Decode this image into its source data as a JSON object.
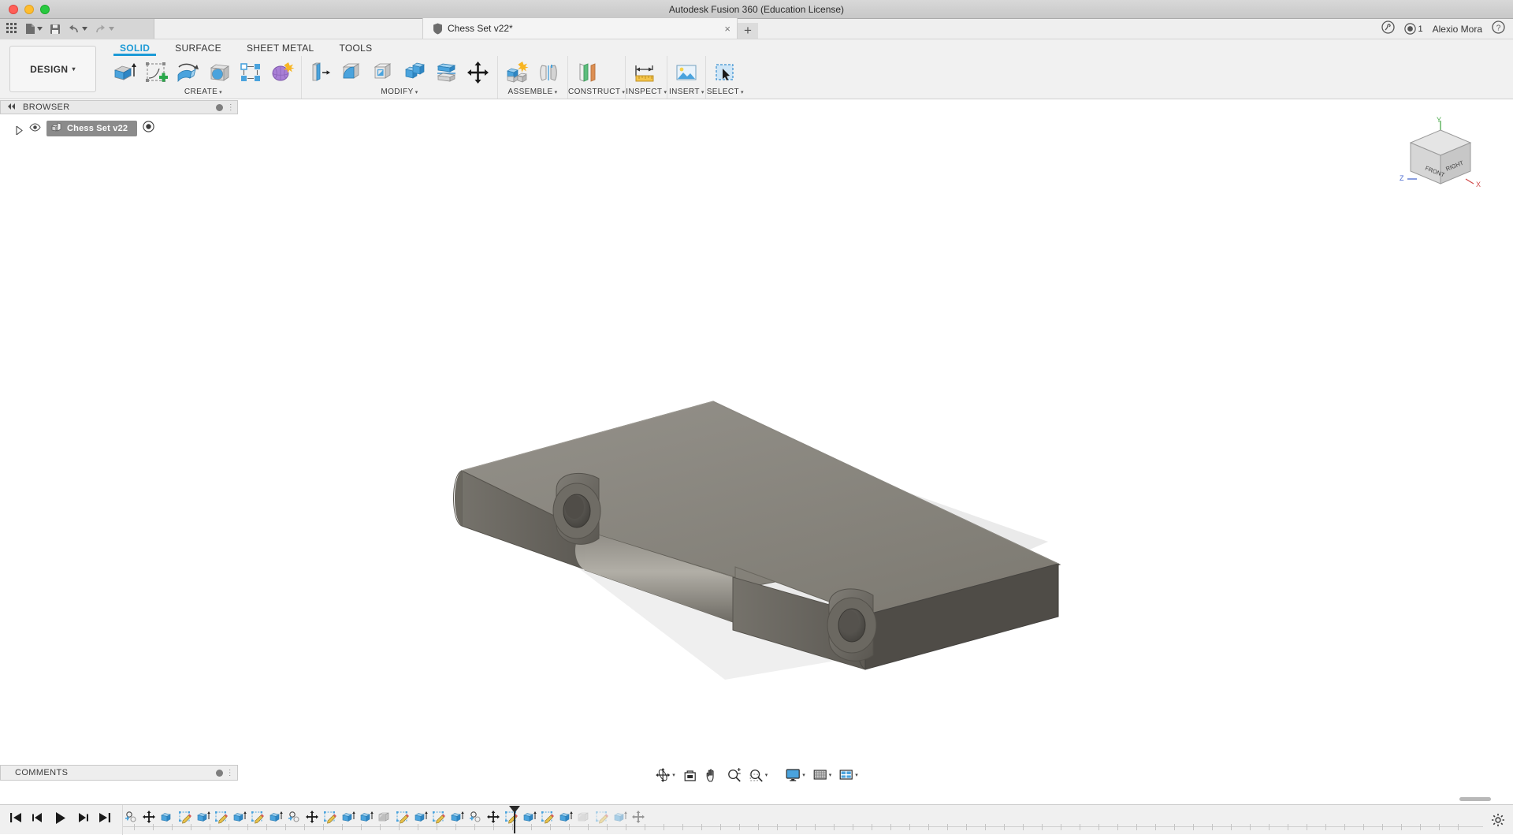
{
  "window": {
    "title": "Autodesk Fusion 360 (Education License)",
    "traffic_lights": [
      "close",
      "minimize",
      "maximize"
    ]
  },
  "quick_access": {
    "items": [
      {
        "name": "app-grid",
        "icon": "grid-icon"
      },
      {
        "name": "new-file",
        "icon": "file-icon",
        "has_dropdown": true
      },
      {
        "name": "save",
        "icon": "save-icon"
      },
      {
        "name": "undo",
        "icon": "undo-icon",
        "has_dropdown": true
      },
      {
        "name": "redo",
        "icon": "redo-icon",
        "has_dropdown": true
      }
    ]
  },
  "document_tab": {
    "label": "Chess Set v22*",
    "close": "×",
    "new_tab": "+"
  },
  "account": {
    "user_name": "Alexio Mora",
    "job_count": "1",
    "help_icon": "question-circle-icon",
    "extension_icon": "activity-icon"
  },
  "workspace": {
    "label": "DESIGN",
    "caret": "▾"
  },
  "ribbon": {
    "tabs": [
      {
        "label": "SOLID",
        "active": true
      },
      {
        "label": "SURFACE",
        "active": false
      },
      {
        "label": "SHEET METAL",
        "active": false
      },
      {
        "label": "TOOLS",
        "active": false
      }
    ],
    "panels": [
      {
        "label": "CREATE",
        "caret": "▾",
        "tools": [
          {
            "name": "extrude-tool",
            "icon": "extrude-icon"
          },
          {
            "name": "create-sketch-tool",
            "icon": "sketch-plus-icon"
          },
          {
            "name": "revolve-tool",
            "icon": "revolve-icon"
          },
          {
            "name": "sphere-tool",
            "icon": "sphere-in-box-icon"
          },
          {
            "name": "pattern-tool",
            "icon": "rect-pattern-icon"
          },
          {
            "name": "form-tool",
            "icon": "form-sculpt-icon"
          }
        ]
      },
      {
        "label": "MODIFY",
        "caret": "▾",
        "tools": [
          {
            "name": "press-pull-tool",
            "icon": "press-pull-icon"
          },
          {
            "name": "fillet-tool",
            "icon": "fillet-icon"
          },
          {
            "name": "shell-tool",
            "icon": "shell-icon"
          },
          {
            "name": "combine-tool",
            "icon": "combine-icon"
          },
          {
            "name": "split-face-tool",
            "icon": "split-face-icon"
          },
          {
            "name": "move-copy-tool",
            "icon": "move-arrows-icon"
          }
        ]
      },
      {
        "label": "ASSEMBLE",
        "caret": "▾",
        "tools": [
          {
            "name": "new-component-tool",
            "icon": "new-component-icon"
          },
          {
            "name": "joint-tool",
            "icon": "joint-icon"
          }
        ]
      },
      {
        "label": "CONSTRUCT",
        "caret": "▾",
        "tools": [
          {
            "name": "offset-plane-tool",
            "icon": "offset-plane-icon"
          }
        ]
      },
      {
        "label": "INSPECT",
        "caret": "▾",
        "tools": [
          {
            "name": "measure-tool",
            "icon": "measure-ruler-icon"
          }
        ]
      },
      {
        "label": "INSERT",
        "caret": "▾",
        "tools": [
          {
            "name": "insert-image-tool",
            "icon": "insert-image-icon"
          }
        ]
      },
      {
        "label": "SELECT",
        "caret": "▾",
        "tools": [
          {
            "name": "select-tool",
            "icon": "marquee-select-icon"
          }
        ]
      }
    ]
  },
  "browser": {
    "title": "BROWSER",
    "collapse_icon": "double-chevron-left-icon",
    "settings_icon": "panel-dot-icon",
    "tree": [
      {
        "label": "Chess Set v22",
        "expand_icon": "triangle-right-icon",
        "visibility_icon": "eye-icon",
        "component_icon": "component-icon",
        "activate_icon": "radio-dot-icon",
        "selected": true
      }
    ]
  },
  "comments": {
    "title": "COMMENTS",
    "settings_icon": "panel-dot-icon"
  },
  "navigation_bar": {
    "items": [
      {
        "name": "orbit-tool",
        "icon": "orbit-icon",
        "has_dropdown": true
      },
      {
        "name": "look-at-tool",
        "icon": "look-at-icon",
        "has_dropdown": false
      },
      {
        "name": "pan-tool",
        "icon": "hand-pan-icon",
        "has_dropdown": false
      },
      {
        "name": "zoom-tool",
        "icon": "zoom-plusminus-icon",
        "has_dropdown": false
      },
      {
        "name": "fit-tool",
        "icon": "zoom-window-icon",
        "has_dropdown": true
      },
      {
        "name": "display-settings",
        "icon": "monitor-icon",
        "has_dropdown": true
      },
      {
        "name": "grid-snaps",
        "icon": "grid-squares-icon",
        "has_dropdown": true
      },
      {
        "name": "viewports",
        "icon": "viewports-icon",
        "has_dropdown": true
      }
    ]
  },
  "timeline": {
    "playback": [
      {
        "name": "go-to-beginning",
        "icon": "skip-back-icon"
      },
      {
        "name": "step-back",
        "icon": "step-back-icon"
      },
      {
        "name": "play",
        "icon": "play-icon"
      },
      {
        "name": "step-forward",
        "icon": "step-forward-icon"
      },
      {
        "name": "go-to-end",
        "icon": "skip-end-icon"
      }
    ],
    "features": [
      {
        "name": "timeline-feature",
        "icon": "new-component-feature-icon"
      },
      {
        "name": "timeline-feature",
        "icon": "move-feature-icon"
      },
      {
        "name": "timeline-feature",
        "icon": "body-feature-icon"
      },
      {
        "name": "timeline-feature",
        "icon": "sketch-feature-icon"
      },
      {
        "name": "timeline-feature",
        "icon": "extrude-feature-icon"
      },
      {
        "name": "timeline-feature",
        "icon": "sketch-feature-icon"
      },
      {
        "name": "timeline-feature",
        "icon": "extrude-feature-icon"
      },
      {
        "name": "timeline-feature",
        "icon": "sketch-feature-icon"
      },
      {
        "name": "timeline-feature",
        "icon": "extrude-feature-icon"
      },
      {
        "name": "timeline-feature",
        "icon": "new-component-feature-icon"
      },
      {
        "name": "timeline-feature",
        "icon": "move-feature-icon"
      },
      {
        "name": "timeline-feature",
        "icon": "sketch-feature-icon"
      },
      {
        "name": "timeline-feature",
        "icon": "extrude-feature-icon"
      },
      {
        "name": "timeline-feature",
        "icon": "extrude-feature-icon"
      },
      {
        "name": "timeline-feature",
        "icon": "fillet-feature-icon"
      },
      {
        "name": "timeline-feature",
        "icon": "sketch-feature-icon"
      },
      {
        "name": "timeline-feature",
        "icon": "extrude-feature-icon"
      },
      {
        "name": "timeline-feature",
        "icon": "sketch-feature-icon"
      },
      {
        "name": "timeline-feature",
        "icon": "extrude-feature-icon"
      },
      {
        "name": "timeline-feature",
        "icon": "new-component-feature-icon"
      },
      {
        "name": "timeline-feature",
        "icon": "move-feature-icon"
      },
      {
        "name": "timeline-feature",
        "icon": "sketch-feature-icon"
      },
      {
        "name": "timeline-feature",
        "icon": "extrude-feature-icon"
      },
      {
        "name": "timeline-feature",
        "icon": "sketch-feature-icon"
      },
      {
        "name": "timeline-feature",
        "icon": "extrude-feature-icon"
      },
      {
        "name": "timeline-feature",
        "icon": "fillet-feature-icon"
      },
      {
        "name": "timeline-feature",
        "icon": "sketch-feature-icon"
      },
      {
        "name": "timeline-feature",
        "icon": "extrude-feature-icon"
      },
      {
        "name": "timeline-feature",
        "icon": "move-feature-icon"
      }
    ],
    "settings_icon": "gear-icon"
  },
  "viewcube": {
    "faces": [
      "FRONT",
      "RIGHT"
    ],
    "axes": {
      "x": "X",
      "y": "Y",
      "z": "Z"
    },
    "colors": {
      "x": "#d04a4a",
      "y": "#4aaa4a",
      "z": "#4a6ad0"
    }
  },
  "model": {
    "name": "hinge-plate-body",
    "description": "3D shaded solid body — rectangular plate with L-shaped slot and two cylindrical bosses with through holes",
    "colors": {
      "top_face": "#8a877f",
      "front_face": "#6e6b63",
      "side_face": "#56534d",
      "shadow": "#d8d8d8"
    }
  },
  "theme": {
    "accent": "#1c9ad6",
    "ribbon_bg": "#f1f1f1",
    "canvas_bg": "#ffffff",
    "panel_bg": "#e9e9e9"
  }
}
